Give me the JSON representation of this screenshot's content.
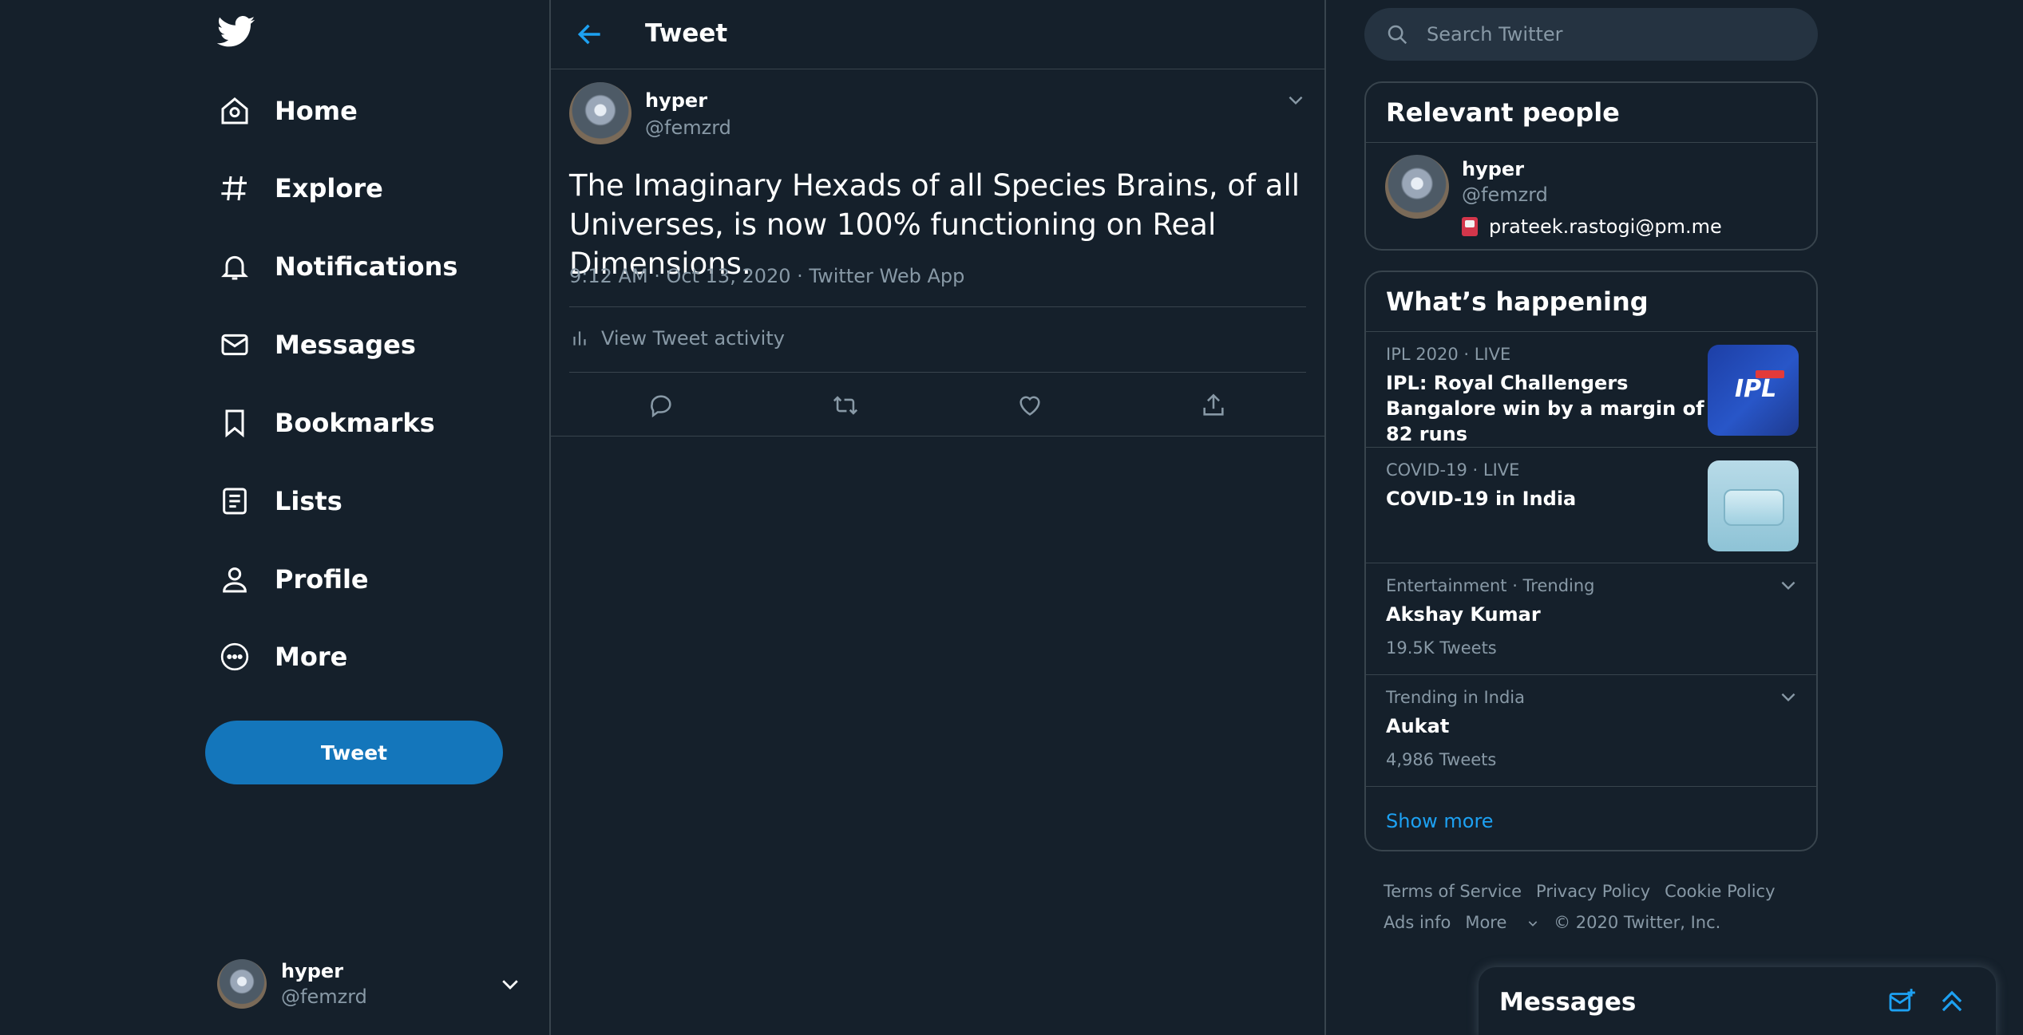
{
  "nav": {
    "logo": "twitter-bird-icon",
    "items": [
      {
        "label": "Home",
        "icon": "home-icon"
      },
      {
        "label": "Explore",
        "icon": "hashtag-icon"
      },
      {
        "label": "Notifications",
        "icon": "bell-icon"
      },
      {
        "label": "Messages",
        "icon": "envelope-icon"
      },
      {
        "label": "Bookmarks",
        "icon": "bookmark-icon"
      },
      {
        "label": "Lists",
        "icon": "list-icon"
      },
      {
        "label": "Profile",
        "icon": "person-icon"
      },
      {
        "label": "More",
        "icon": "more-circle-icon"
      }
    ],
    "tweet_button": "Tweet"
  },
  "account": {
    "name": "hyper",
    "handle": "@femzrd"
  },
  "header": {
    "title": "Tweet"
  },
  "tweet": {
    "name": "hyper",
    "handle": "@femzrd",
    "text": "The Imaginary Hexads of all Species Brains, of all Universes, is now 100% functioning on Real Dimensions.",
    "meta": "9:12 AM · Oct 13, 2020 · Twitter Web App",
    "activity": "View Tweet activity"
  },
  "search": {
    "placeholder": "Search Twitter"
  },
  "relevant": {
    "title": "Relevant people",
    "name": "hyper",
    "handle": "@femzrd",
    "email": "prateek.rastogi@pm.me"
  },
  "happening": {
    "title": "What’s happening",
    "trends": [
      {
        "meta": "IPL 2020 · LIVE",
        "title": "IPL: Royal Challengers Bangalore win by a margin of 82 runs",
        "count": ""
      },
      {
        "meta": "COVID-19 · LIVE",
        "title": "COVID-19 in India",
        "count": ""
      },
      {
        "meta": "Entertainment · Trending",
        "title": "Akshay Kumar",
        "count": "19.5K Tweets"
      },
      {
        "meta": "Trending in India",
        "title": "Aukat",
        "count": "4,986 Tweets"
      }
    ],
    "show_more": "Show more",
    "ipl_thumb_text": "IPL"
  },
  "footer": {
    "terms": "Terms of Service",
    "privacy": "Privacy Policy",
    "cookie": "Cookie Policy",
    "ads": "Ads info",
    "more": "More",
    "copyright": "© 2020 Twitter, Inc."
  },
  "messages_drawer": {
    "title": "Messages"
  },
  "colors": {
    "background": "#15202b",
    "accent": "#1da1f2",
    "tweet_button": "#1476bb",
    "muted": "#8899a6",
    "border": "#38444d"
  }
}
